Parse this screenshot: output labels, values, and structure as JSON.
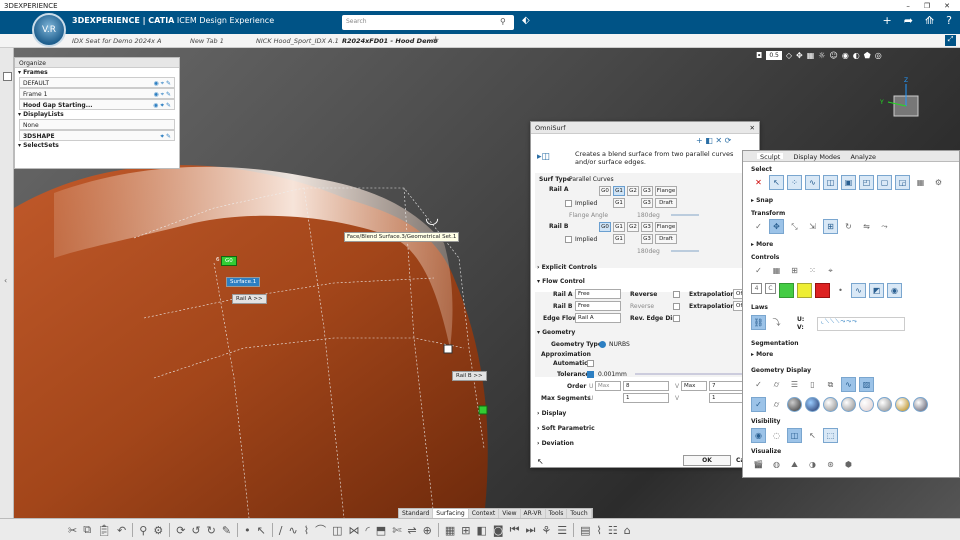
{
  "titlebar": {
    "app": "3DEXPERIENCE"
  },
  "header": {
    "brand_prefix": "3DEXPERIENCE | CATIA",
    "brand_suffix": "ICEM Design Experience",
    "search_placeholder": "Search",
    "compass_label": "V.R"
  },
  "tabs": [
    {
      "label": "IDX Seat for Demo 2024x A"
    },
    {
      "label": "New Tab 1"
    },
    {
      "label": "NICK Hood_Sport_IDX A.1"
    },
    {
      "label": "R2024xFD01 - Hood Demo"
    }
  ],
  "tree": {
    "header": "Organize",
    "frames_title": "Frames",
    "frames": [
      "DEFAULT",
      "Frame 1",
      "Hood Gap Starting..."
    ],
    "displaylists_title": "DisplayLists",
    "displaylists": [
      "None",
      "3DSHAPE"
    ],
    "selectsets_title": "SelectSets"
  },
  "viewport": {
    "zoom": "0.5",
    "tooltip": "Face/Blend Surface.3/Geometrical Set.1",
    "labels": {
      "g0_num": "6",
      "g0": "G0",
      "surface": "Surface.1",
      "rail_a": "Rail A >>",
      "rail_b": "Rail B >>"
    },
    "axes": {
      "x": "X",
      "y": "Y",
      "z": "Z"
    }
  },
  "omnisurf": {
    "title": "OmniSurf",
    "description": "Creates a blend surface from two parallel curves and/or surface edges.",
    "surf_type_label": "Surf Type",
    "surf_type_value": "Parallel Curves",
    "rail_a": "Rail A",
    "rail_b": "Rail B",
    "continuity": [
      "G0",
      "G1",
      "G2",
      "G3"
    ],
    "flange": "Flange",
    "implied": "Implied",
    "draft": "Draft",
    "flange_angle": "Flange Angle",
    "angle_value": "180deg",
    "explicit_controls": "Explicit Controls",
    "flow_control": "Flow Control",
    "flow_rail_a": "Rail A",
    "flow_rail_b": "Rail B",
    "edge_flow": "Edge Flow",
    "free": "Free",
    "edge_flow_value": "Rail A",
    "reverse": "Reverse",
    "rev_edge_dir": "Rev. Edge Dir.",
    "extrapolation": "Extrapolation",
    "off": "Off",
    "geometry": "Geometry",
    "geometry_type_label": "Geometry Type",
    "geometry_type_value": "NURBS",
    "approximation": "Approximation",
    "automatic": "Automatic",
    "tolerance": "Tolerance",
    "tolerance_value": "0.001mm",
    "order": "Order",
    "u": "U",
    "v": "V",
    "max": "Max",
    "order_u": "8",
    "order_v": "7",
    "max_segments": "Max Segments",
    "seg_u": "1",
    "seg_v": "1",
    "display": "Display",
    "soft_parametric": "Soft Parametric",
    "deviation": "Deviation",
    "ok": "OK",
    "cancel": "Ca"
  },
  "sculpt": {
    "tabs": [
      "Sculpt",
      "Display Modes",
      "Analyze"
    ],
    "sections": [
      "Select",
      "Snap",
      "Transform",
      "More",
      "Controls",
      "Laws",
      "Segmentation",
      "More",
      "Geometry Display",
      "Visibility",
      "Visualize"
    ],
    "controls_nums": [
      "4",
      "C"
    ],
    "laws_u": "U:",
    "laws_v": "V:"
  },
  "bottom_tabs": [
    "Standard",
    "Surfacing",
    "Context",
    "View",
    "AR-VR",
    "Tools",
    "Touch"
  ],
  "colors": {
    "brand": "#005386",
    "surface": "#b5501f",
    "accent": "#2d7fc2"
  }
}
